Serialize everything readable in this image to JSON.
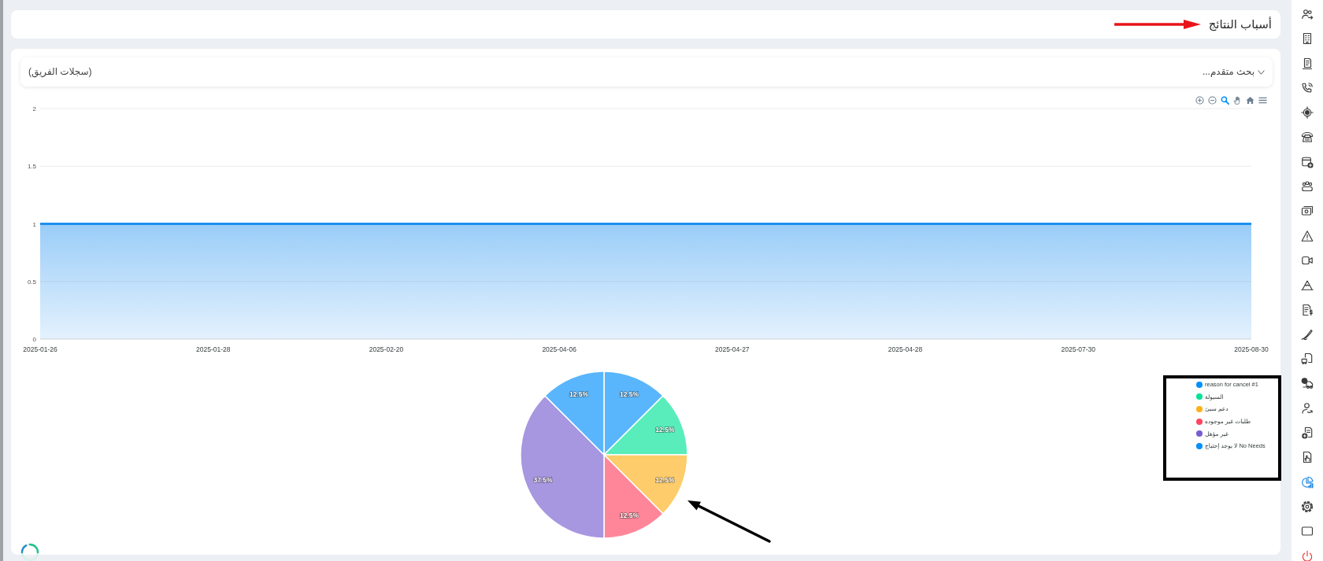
{
  "header": {
    "title": "أسباب النتائج"
  },
  "filter_bar": {
    "toggle_label": "بحث متقدم...",
    "expanded": false,
    "scope_label": "(سجلات الفريق)"
  },
  "chart_toolbar": [
    {
      "kind": "zoom-in",
      "selected": false
    },
    {
      "kind": "zoom-out",
      "selected": false
    },
    {
      "kind": "zoom",
      "selected": true
    },
    {
      "kind": "pan",
      "selected": false
    },
    {
      "kind": "reset",
      "selected": false
    },
    {
      "kind": "menu",
      "selected": false
    }
  ],
  "line_chart": {
    "chart_data": {
      "type": "area",
      "categories": [
        "2025-01-26",
        "2025-01-28",
        "2025-02-20",
        "2025-04-06",
        "2025-04-27",
        "2025-04-28",
        "2025-07-30",
        "2025-08-30"
      ],
      "series": [
        {
          "color": "#1e8ff0",
          "values": [
            1,
            1,
            1,
            1,
            1,
            1,
            1,
            1
          ]
        }
      ],
      "ylim": [
        0,
        2
      ],
      "yticks": [
        0,
        0.5,
        1,
        1.5,
        2
      ]
    }
  },
  "pie_chart": {
    "chart_data": {
      "type": "pie",
      "categories": [
        "reason for cancel #1",
        "السيولة",
        "دعم سيئ",
        "طلبات غير موجوده",
        "غير مؤهل",
        "لا يوجد إحتياج No Needs"
      ],
      "values": [
        12.5,
        12.5,
        12.5,
        12.5,
        37.5,
        12.5
      ],
      "value_labels": [
        "12.5%",
        "12.5%",
        "12.5%",
        "12.5%",
        "37.5%",
        "12.5%"
      ]
    },
    "legend_markers": [
      {
        "color": "#008ffb"
      },
      {
        "color": "#00e396"
      },
      {
        "color": "#feb019"
      },
      {
        "color": "#ff4560"
      },
      {
        "color": "#775dd0"
      },
      {
        "color": "#008ffb"
      }
    ]
  },
  "sidebar": {
    "items": [
      {
        "kind": "users",
        "selected": false
      },
      {
        "kind": "building",
        "selected": false
      },
      {
        "kind": "scroll",
        "selected": false
      },
      {
        "kind": "phone-signal",
        "selected": false
      },
      {
        "kind": "target",
        "selected": false
      },
      {
        "kind": "telephone",
        "selected": false
      },
      {
        "kind": "calendar-add",
        "selected": false
      },
      {
        "kind": "team",
        "selected": false
      },
      {
        "kind": "cash",
        "selected": false
      },
      {
        "kind": "warning",
        "selected": false
      },
      {
        "kind": "video",
        "selected": false
      },
      {
        "kind": "mountain",
        "selected": false
      },
      {
        "kind": "invoice",
        "selected": false
      },
      {
        "kind": "signature",
        "selected": false
      },
      {
        "kind": "doc-truck",
        "selected": false
      },
      {
        "kind": "truck-globe",
        "selected": false
      },
      {
        "kind": "user-arrow",
        "selected": false
      },
      {
        "kind": "doc-add",
        "selected": false
      },
      {
        "kind": "doc-hand",
        "selected": false
      },
      {
        "kind": "pie",
        "selected": true
      },
      {
        "kind": "gear",
        "selected": false
      },
      {
        "kind": "screen",
        "selected": false
      },
      {
        "kind": "power",
        "selected": false
      }
    ]
  }
}
